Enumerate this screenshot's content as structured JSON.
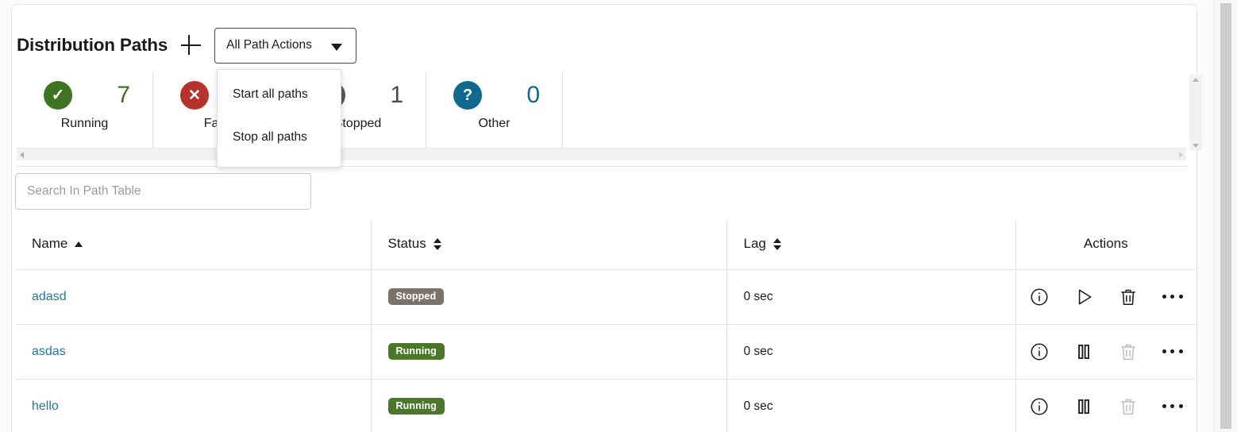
{
  "header": {
    "title": "Distribution Paths",
    "add_icon": "plus-icon",
    "actions_select_label": "All Path Actions",
    "caret_icon": "chevron-down-icon"
  },
  "dropdown": {
    "open": true,
    "items": [
      {
        "label": "Start all paths",
        "name": "menu-item-start-all-paths"
      },
      {
        "label": "Stop all paths",
        "name": "menu-item-stop-all-paths"
      }
    ]
  },
  "summary": {
    "cards": [
      {
        "label": "Running",
        "count": "7",
        "icon": "check-circle-icon",
        "icon_bg": "#3e7421",
        "count_color": "#3e7421"
      },
      {
        "label": "Failed",
        "count": "",
        "icon": "x-circle-icon",
        "icon_bg": "#b5332a",
        "count_color": "#b5332a"
      },
      {
        "label": "Stopped",
        "count": "1",
        "icon": "stop-circle-icon",
        "icon_bg": "#595959",
        "count_color": "#4a4a4a"
      },
      {
        "label": "Other",
        "count": "0",
        "icon": "question-circle-icon",
        "icon_bg": "#10698c",
        "count_color": "#10698c"
      }
    ]
  },
  "search": {
    "placeholder": "Search In Path Table",
    "value": ""
  },
  "table": {
    "columns": [
      {
        "label": "Name",
        "sort": "asc",
        "name": "column-header-name"
      },
      {
        "label": "Status",
        "sort": "both",
        "name": "column-header-status"
      },
      {
        "label": "Lag",
        "sort": "both",
        "name": "column-header-lag"
      },
      {
        "label": "Actions",
        "sort": "none",
        "name": "column-header-actions"
      }
    ],
    "rows": [
      {
        "name": "adasd",
        "status": "Stopped",
        "status_color": "#7a736c",
        "lag": "0 sec",
        "play_action": "play-icon",
        "delete_enabled": true
      },
      {
        "name": "asdas",
        "status": "Running",
        "status_color": "#4a7729",
        "lag": "0 sec",
        "play_action": "pause-icon",
        "delete_enabled": false
      },
      {
        "name": "hello",
        "status": "Running",
        "status_color": "#4a7729",
        "lag": "0 sec",
        "play_action": "pause-icon",
        "delete_enabled": false
      }
    ],
    "row_action_icons": {
      "info": "info-circle-icon",
      "delete": "trash-icon",
      "more": "ellipsis-icon"
    }
  },
  "colors": {
    "link": "#26799c",
    "green": "#4a7729",
    "red": "#b5332a",
    "gray": "#7a736c",
    "blue": "#10698c"
  }
}
